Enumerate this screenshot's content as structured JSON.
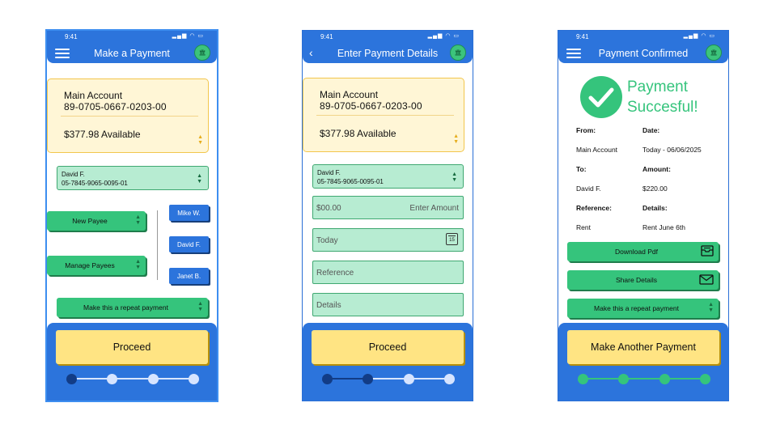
{
  "colors": {
    "primary_blue": "#2c74dc",
    "green": "#35c47c",
    "light_green": "#b7ecd2",
    "yellow": "#ffe483",
    "card_yellow": "#fff6d6"
  },
  "status_time": "9:41",
  "screen1": {
    "title": "Make a Payment",
    "account_name": "Main Account",
    "account_number": "89-0705-0667-0203-00",
    "balance": "$377.98 Available",
    "payee_name": "David F.",
    "payee_number": "05-7845-9065-0095-01",
    "new_payee_label": "New Payee",
    "manage_payees_label": "Manage Payees",
    "quick_payees": [
      "Mike W.",
      "David F.",
      "Janet B."
    ],
    "repeat_label": "Make this a repeat payment",
    "proceed_label": "Proceed",
    "step_current": 1,
    "step_total": 4
  },
  "screen2": {
    "title": "Enter Payment Details",
    "account_name": "Main Account",
    "account_number": "89-0705-0667-0203-00",
    "balance": "$377.98 Available",
    "payee_name": "David F.",
    "payee_number": "05-7845-9065-0095-01",
    "amount_prefix": "$00.00",
    "amount_placeholder": "Enter Amount",
    "date_placeholder": "Today",
    "calendar_day": "15",
    "reference_placeholder": "Reference",
    "details_placeholder": "Details",
    "proceed_label": "Proceed",
    "step_current": 2,
    "step_total": 4
  },
  "screen3": {
    "title": "Payment Confirmed",
    "success_line1": "Payment",
    "success_line2": "Succesful!",
    "from_label": "From:",
    "from_value": "Main Account",
    "date_label": "Date:",
    "date_value": "Today - 06/06/2025",
    "to_label": "To:",
    "to_value": "David F.",
    "amount_label": "Amount:",
    "amount_value": "$220.00",
    "reference_label": "Reference:",
    "reference_value": "Rent",
    "details_label": "Details:",
    "details_value": "Rent June 6th",
    "download_label": "Download Pdf",
    "share_label": "Share Details",
    "repeat_label": "Make this a repeat payment",
    "another_label": "Make Another Payment",
    "step_current": 4,
    "step_total": 4
  }
}
